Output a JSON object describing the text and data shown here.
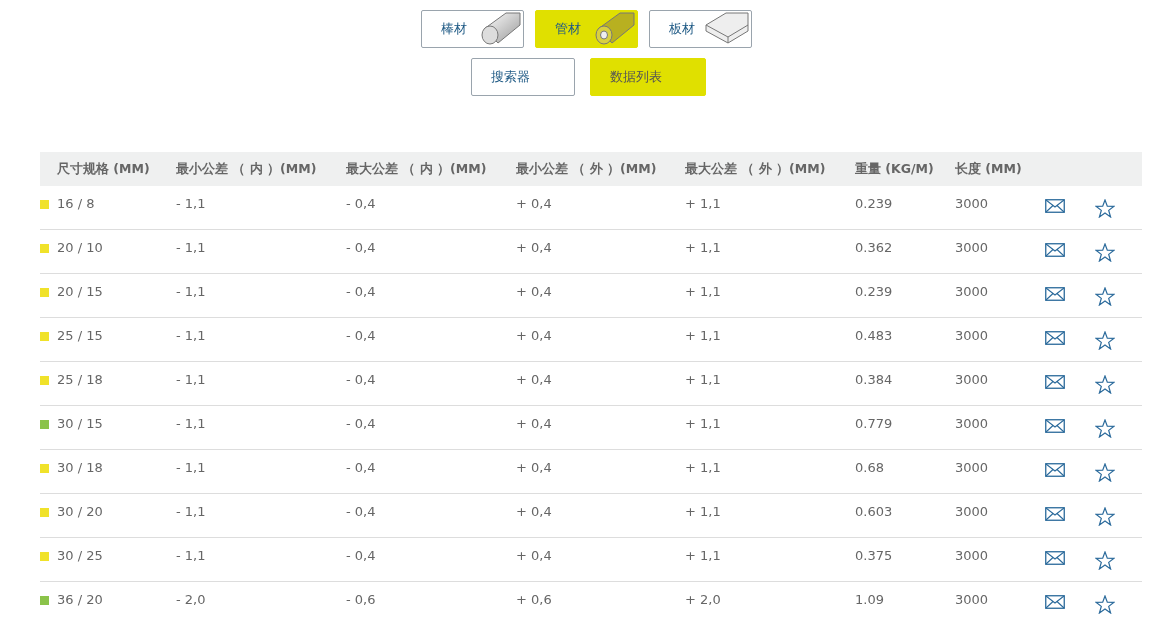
{
  "material_tabs": [
    {
      "label": "棒材",
      "kind": "rod",
      "selected": false
    },
    {
      "label": "管材",
      "kind": "tube",
      "selected": true
    },
    {
      "label": "板材",
      "kind": "plate",
      "selected": false
    }
  ],
  "view_tabs": [
    {
      "label": "搜索器",
      "selected": false
    },
    {
      "label": "数据列表",
      "selected": true
    }
  ],
  "table": {
    "columns": [
      "尺寸规格 (MM)",
      "最小公差 （ 内 ）(MM)",
      "最大公差 （ 内 ）(MM)",
      "最小公差 （ 外 ）(MM)",
      "最大公差 （ 外 ）(MM)",
      "重量 (KG/M)",
      "长度 (MM)"
    ],
    "rows": [
      {
        "color": "#f0e22a",
        "cells": [
          "16 / 8",
          "- 1,1",
          "- 0,4",
          "+ 0,4",
          "+ 1,1",
          "0.239",
          "3000"
        ]
      },
      {
        "color": "#f0e22a",
        "cells": [
          "20 / 10",
          "- 1,1",
          "- 0,4",
          "+ 0,4",
          "+ 1,1",
          "0.362",
          "3000"
        ]
      },
      {
        "color": "#f0e22a",
        "cells": [
          "20 / 15",
          "- 1,1",
          "- 0,4",
          "+ 0,4",
          "+ 1,1",
          "0.239",
          "3000"
        ]
      },
      {
        "color": "#f0e22a",
        "cells": [
          "25 / 15",
          "- 1,1",
          "- 0,4",
          "+ 0,4",
          "+ 1,1",
          "0.483",
          "3000"
        ]
      },
      {
        "color": "#f0e22a",
        "cells": [
          "25 / 18",
          "- 1,1",
          "- 0,4",
          "+ 0,4",
          "+ 1,1",
          "0.384",
          "3000"
        ]
      },
      {
        "color": "#8bc34a",
        "cells": [
          "30 / 15",
          "- 1,1",
          "- 0,4",
          "+ 0,4",
          "+ 1,1",
          "0.779",
          "3000"
        ]
      },
      {
        "color": "#f0e22a",
        "cells": [
          "30 / 18",
          "- 1,1",
          "- 0,4",
          "+ 0,4",
          "+ 1,1",
          "0.68",
          "3000"
        ]
      },
      {
        "color": "#f0e22a",
        "cells": [
          "30 / 20",
          "- 1,1",
          "- 0,4",
          "+ 0,4",
          "+ 1,1",
          "0.603",
          "3000"
        ]
      },
      {
        "color": "#f0e22a",
        "cells": [
          "30 / 25",
          "- 1,1",
          "- 0,4",
          "+ 0,4",
          "+ 1,1",
          "0.375",
          "3000"
        ]
      },
      {
        "color": "#8bc34a",
        "cells": [
          "36 / 20",
          "- 2,0",
          "- 0,6",
          "+ 0,6",
          "+ 2,0",
          "1.09",
          "3000"
        ]
      }
    ]
  }
}
